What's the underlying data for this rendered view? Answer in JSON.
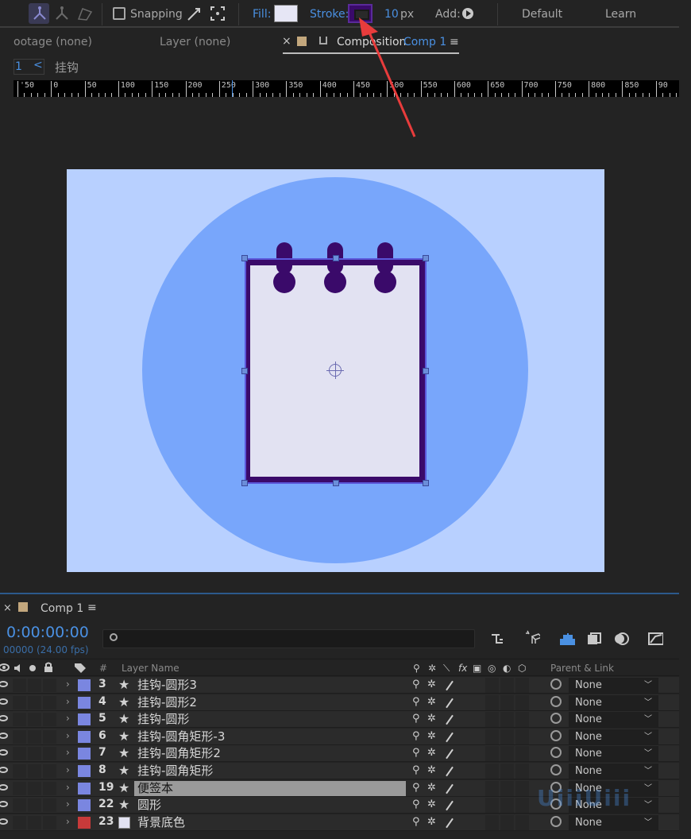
{
  "toolbar": {
    "snapping_label": "Snapping",
    "fill_label": "Fill:",
    "fill_color": "#e6e6f5",
    "stroke_label": "Stroke:",
    "stroke_color": "#3a0a6a",
    "stroke_width": "10",
    "stroke_unit": "px",
    "add_label": "Add:",
    "workspace_default": "Default",
    "workspace_learn": "Learn"
  },
  "panel_tabs": {
    "footage": "ootage  (none)",
    "layer": "Layer  (none)",
    "composition_label": "Composition",
    "composition_name": "Comp 1",
    "close": "×",
    "menu": "≡"
  },
  "breadcrumb": {
    "number": "1",
    "arrow": "<",
    "name": "挂钩"
  },
  "ruler": {
    "labels": [
      "'50",
      "0",
      "50",
      "100",
      "150",
      "200",
      "250",
      "300",
      "350",
      "400",
      "450",
      "500",
      "550",
      "600",
      "650",
      "700",
      "750",
      "800",
      "850",
      "90"
    ]
  },
  "canvas": {
    "background_color": "#b8d0ff",
    "circle_color": "#78a6fb",
    "note_fill": "#e2e2f2",
    "note_stroke": "#3a0a6a"
  },
  "timeline": {
    "close": "×",
    "comp_name": "Comp 1",
    "menu": "≡",
    "timecode": "0:00:00:00",
    "fps": "00000 (24.00 fps)",
    "search_placeholder": "",
    "columns": {
      "number": "#",
      "layer_name": "Layer Name",
      "parent_link": "Parent & Link",
      "fx": "fx"
    },
    "layers": [
      {
        "num": "3",
        "name": "挂钩-圆形3",
        "label_color": "#7a86e0",
        "type": "star",
        "parent": "None",
        "selected": false
      },
      {
        "num": "4",
        "name": "挂钩-圆形2",
        "label_color": "#7a86e0",
        "type": "star",
        "parent": "None",
        "selected": false
      },
      {
        "num": "5",
        "name": "挂钩-圆形",
        "label_color": "#7a86e0",
        "type": "star",
        "parent": "None",
        "selected": false
      },
      {
        "num": "6",
        "name": "挂钩-圆角矩形-3",
        "label_color": "#7a86e0",
        "type": "star",
        "parent": "None",
        "selected": false
      },
      {
        "num": "7",
        "name": "挂钩-圆角矩形2",
        "label_color": "#7a86e0",
        "type": "star",
        "parent": "None",
        "selected": false
      },
      {
        "num": "8",
        "name": "挂钩-圆角矩形",
        "label_color": "#7a86e0",
        "type": "star",
        "parent": "None",
        "selected": false
      },
      {
        "num": "19",
        "name": "便签本",
        "label_color": "#7a86e0",
        "type": "star",
        "parent": "None",
        "selected": true
      },
      {
        "num": "22",
        "name": "圆形",
        "label_color": "#7a86e0",
        "type": "star",
        "parent": "None",
        "selected": false
      },
      {
        "num": "23",
        "name": "背景底色",
        "label_color": "#c83a3a",
        "type": "solid",
        "parent": "None",
        "selected": false
      }
    ]
  },
  "watermark": "UiiiUiii"
}
